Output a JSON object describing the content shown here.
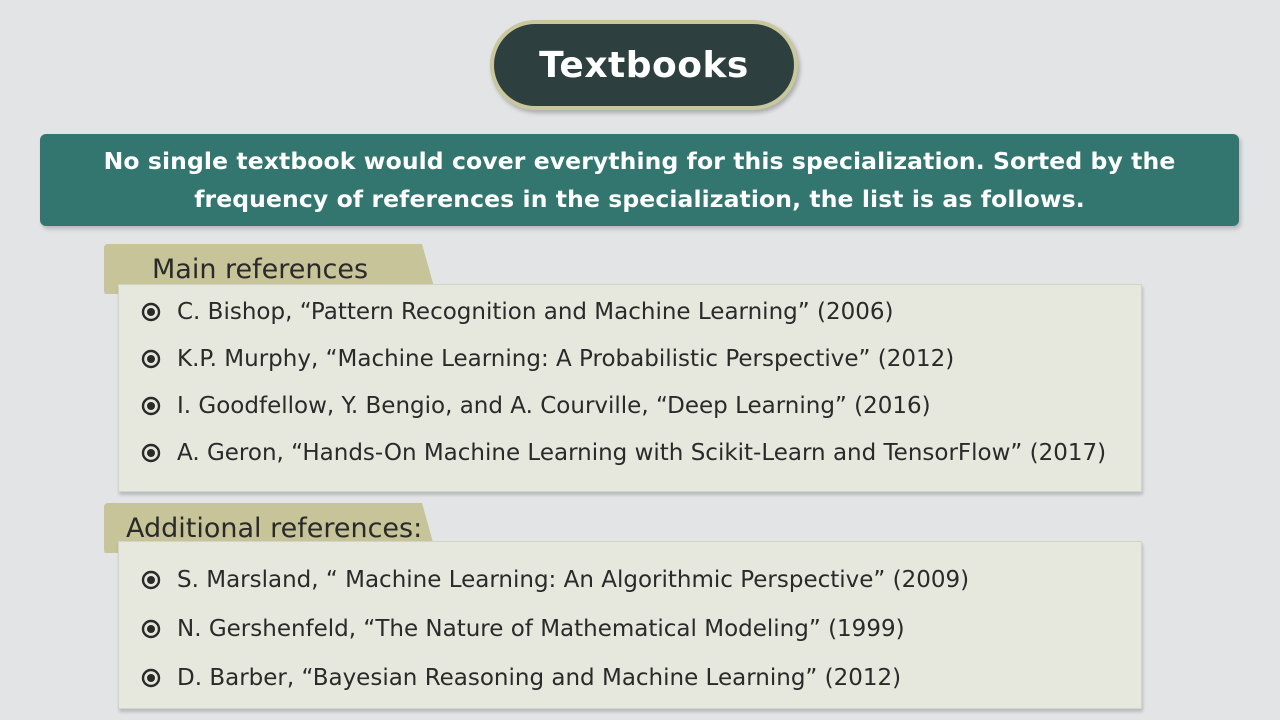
{
  "title": "Textbooks",
  "intro": "No single textbook would cover everything for this specialization. Sorted by the frequency of references in the specialization, the list is as follows.",
  "main_section": {
    "heading": "Main references",
    "items": [
      "C. Bishop, “Pattern Recognition and Machine Learning” (2006)",
      "K.P. Murphy, “Machine Learning: A Probabilistic Perspective” (2012)",
      "I. Goodfellow, Y. Bengio, and A. Courville, “Deep Learning” (2016)",
      "A. Geron, “Hands-On Machine Learning with Scikit-Learn and TensorFlow” (2017)"
    ]
  },
  "additional_section": {
    "heading": "Additional references:",
    "items": [
      "S. Marsland, “ Machine Learning: An Algorithmic Perspective” (2009)",
      "N. Gershenfeld, “The Nature of Mathematical Modeling” (1999)",
      "D. Barber, “Bayesian Reasoning and Machine Learning” (2012)"
    ]
  },
  "colors": {
    "background": "#e3e4e6",
    "title_pill": "#2d3f3f",
    "title_border": "#c9c79b",
    "intro_box": "#32766f",
    "tab": "#c6c498",
    "panel": "#e6e7dd",
    "bullet": "#2a2a2a"
  },
  "icons": {
    "bullet": "circled-dot-bullet-icon"
  }
}
